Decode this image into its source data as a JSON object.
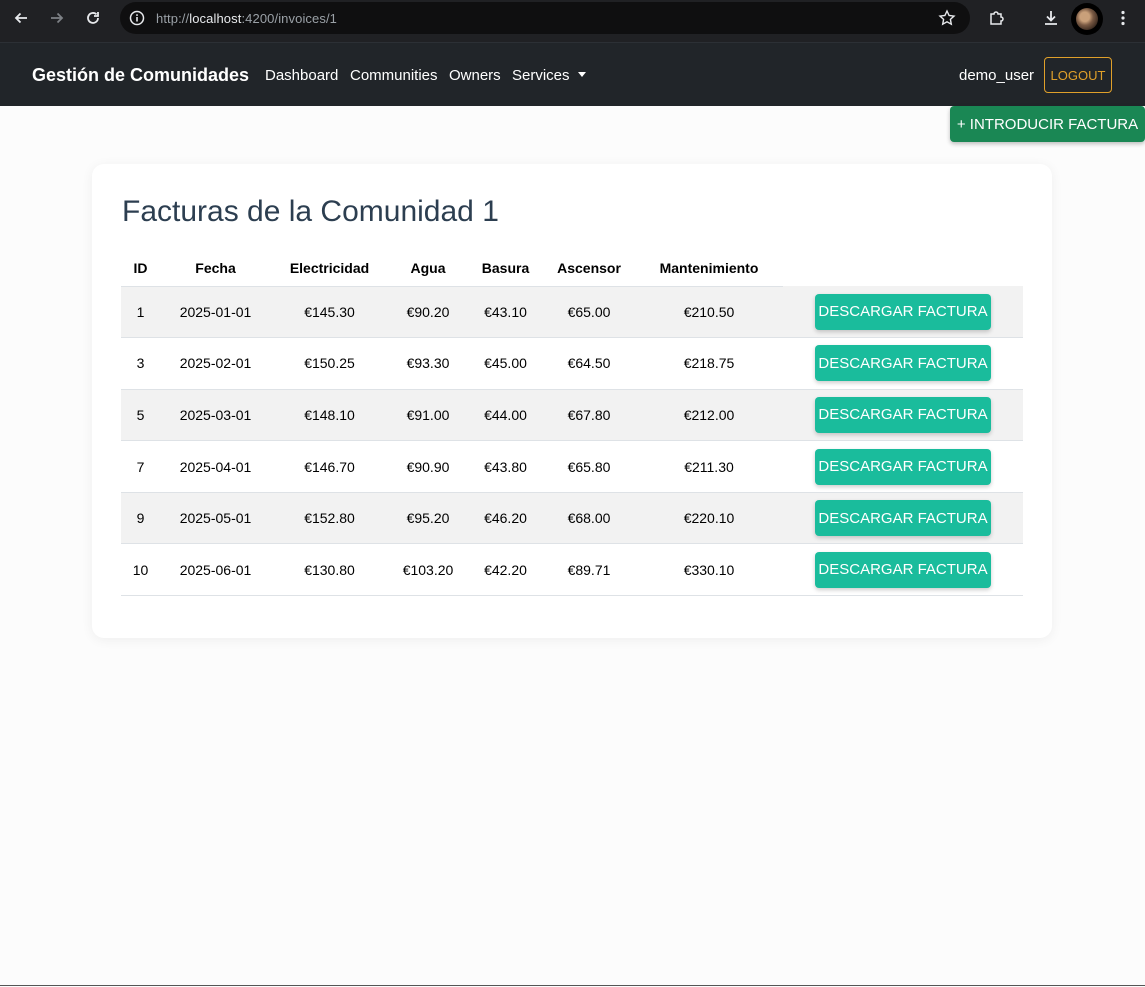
{
  "browser": {
    "url_prefix": "http://",
    "url_host": "localhost",
    "url_rest": ":4200/invoices/1"
  },
  "navbar": {
    "brand": "Gestión de Comunidades",
    "links": [
      "Dashboard",
      "Communities",
      "Owners",
      "Services"
    ],
    "user": "demo_user",
    "logout_label": "LOGOUT"
  },
  "actions": {
    "add_invoice_label": "+ INTRODUCIR FACTURA"
  },
  "page": {
    "title": "Facturas de la Comunidad 1"
  },
  "table": {
    "columns": [
      "ID",
      "Fecha",
      "Electricidad",
      "Agua",
      "Basura",
      "Ascensor",
      "Mantenimiento",
      ""
    ],
    "download_label": "DESCARGAR FACTURA",
    "rows": [
      {
        "id": "1",
        "fecha": "2025-01-01",
        "electricidad": "€145.30",
        "agua": "€90.20",
        "basura": "€43.10",
        "ascensor": "€65.00",
        "mantenimiento": "€210.50"
      },
      {
        "id": "3",
        "fecha": "2025-02-01",
        "electricidad": "€150.25",
        "agua": "€93.30",
        "basura": "€45.00",
        "ascensor": "€64.50",
        "mantenimiento": "€218.75"
      },
      {
        "id": "5",
        "fecha": "2025-03-01",
        "electricidad": "€148.10",
        "agua": "€91.00",
        "basura": "€44.00",
        "ascensor": "€67.80",
        "mantenimiento": "€212.00"
      },
      {
        "id": "7",
        "fecha": "2025-04-01",
        "electricidad": "€146.70",
        "agua": "€90.90",
        "basura": "€43.80",
        "ascensor": "€65.80",
        "mantenimiento": "€211.30"
      },
      {
        "id": "9",
        "fecha": "2025-05-01",
        "electricidad": "€152.80",
        "agua": "€95.20",
        "basura": "€46.20",
        "ascensor": "€68.00",
        "mantenimiento": "€220.10"
      },
      {
        "id": "10",
        "fecha": "2025-06-01",
        "electricidad": "€130.80",
        "agua": "€103.20",
        "basura": "€42.20",
        "ascensor": "€89.71",
        "mantenimiento": "€330.10"
      }
    ]
  },
  "colors": {
    "navbar_bg": "#212529",
    "logout_accent": "#e0a02a",
    "add_button": "#1a8754",
    "download_button": "#1abc9c",
    "title": "#2c3e50"
  }
}
